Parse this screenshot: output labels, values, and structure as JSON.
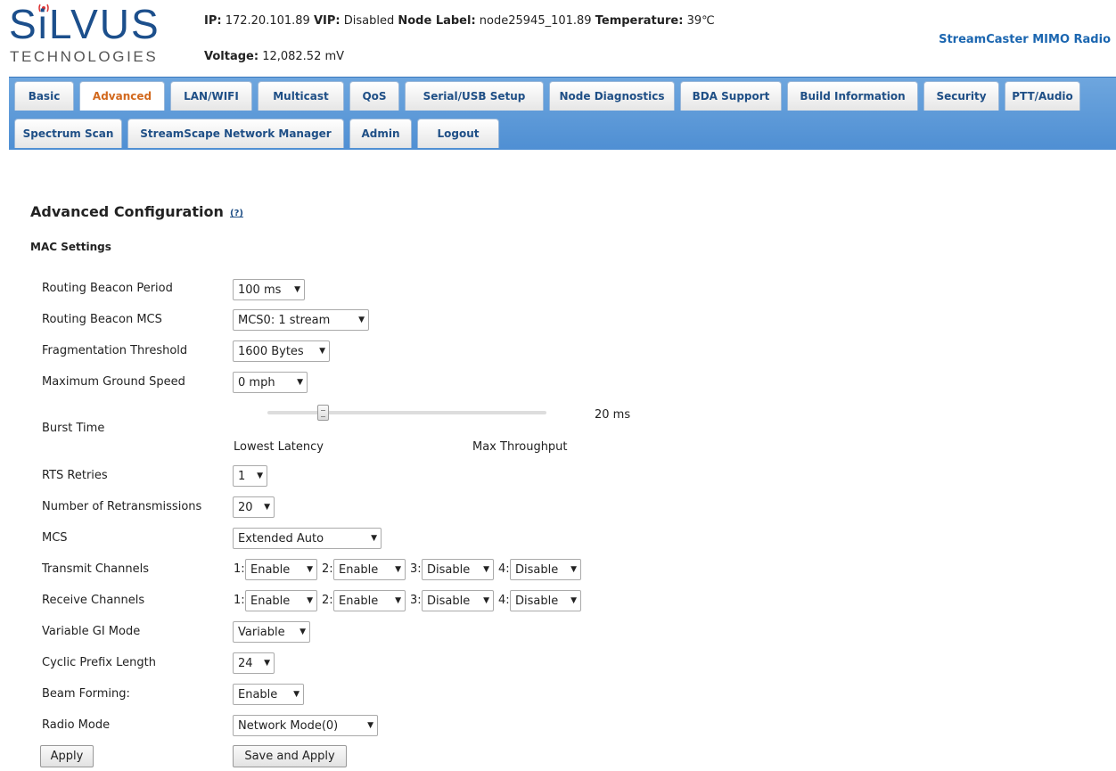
{
  "brand": {
    "logo_word": "SiLVUS",
    "logo_sub": "TECHNOLOGIES",
    "product": "StreamCaster MIMO Radio"
  },
  "status": {
    "ip_label": "IP:",
    "ip": "172.20.101.89",
    "vip_label": "VIP:",
    "vip": "Disabled",
    "node_label_label": "Node Label:",
    "node_label": "node25945_101.89",
    "temperature_label": "Temperature:",
    "temperature": "39℃",
    "voltage_label": "Voltage:",
    "voltage": "12,082.52 mV"
  },
  "tabs_row1": [
    "Basic",
    "Advanced",
    "LAN/WIFI",
    "Multicast",
    "QoS",
    "Serial/USB Setup",
    "Node Diagnostics",
    "BDA Support",
    "Build Information",
    "Security",
    "PTT/Audio"
  ],
  "tabs_row2": [
    "Spectrum Scan",
    "StreamScape Network Manager",
    "Admin",
    "Logout"
  ],
  "active_tab": "Advanced",
  "page": {
    "title": "Advanced Configuration",
    "help": "(?)",
    "section": "MAC Settings"
  },
  "fields": {
    "routing_beacon_period": {
      "label": "Routing Beacon Period",
      "value": "100 ms"
    },
    "routing_beacon_mcs": {
      "label": "Routing Beacon MCS",
      "value": "MCS0: 1 stream"
    },
    "fragmentation_threshold": {
      "label": "Fragmentation Threshold",
      "value": "1600 Bytes"
    },
    "max_ground_speed": {
      "label": "Maximum Ground Speed",
      "value": "0 mph"
    },
    "burst_time": {
      "label": "Burst Time",
      "value": "20 ms",
      "min_label": "Lowest Latency",
      "max_label": "Max Throughput",
      "level": 0.2
    },
    "rts_retries": {
      "label": "RTS Retries",
      "value": "1"
    },
    "num_retransmissions": {
      "label": "Number of Retransmissions",
      "value": "20"
    },
    "mcs": {
      "label": "MCS",
      "value": "Extended Auto"
    },
    "transmit_channels": {
      "label": "Transmit Channels",
      "channels": [
        {
          "num": "1:",
          "value": "Enable"
        },
        {
          "num": "2:",
          "value": "Enable"
        },
        {
          "num": "3:",
          "value": "Disable"
        },
        {
          "num": "4:",
          "value": "Disable"
        }
      ]
    },
    "receive_channels": {
      "label": "Receive Channels",
      "channels": [
        {
          "num": "1:",
          "value": "Enable"
        },
        {
          "num": "2:",
          "value": "Enable"
        },
        {
          "num": "3:",
          "value": "Disable"
        },
        {
          "num": "4:",
          "value": "Disable"
        }
      ]
    },
    "variable_gi_mode": {
      "label": "Variable GI Mode",
      "value": "Variable"
    },
    "cyclic_prefix_length": {
      "label": "Cyclic Prefix Length",
      "value": "24"
    },
    "beam_forming": {
      "label": "Beam Forming:",
      "value": "Enable"
    },
    "radio_mode": {
      "label": "Radio Mode",
      "value": "Network Mode(0)"
    }
  },
  "buttons": {
    "apply": "Apply",
    "save_apply": "Save and Apply"
  },
  "colors": {
    "brand_blue": "#1c4f8c",
    "tabbar_blue": "#4f8fd3",
    "tab_text": "#1f4f86",
    "active_tab_text": "#d2691e",
    "product_blue": "#1b66b0"
  }
}
